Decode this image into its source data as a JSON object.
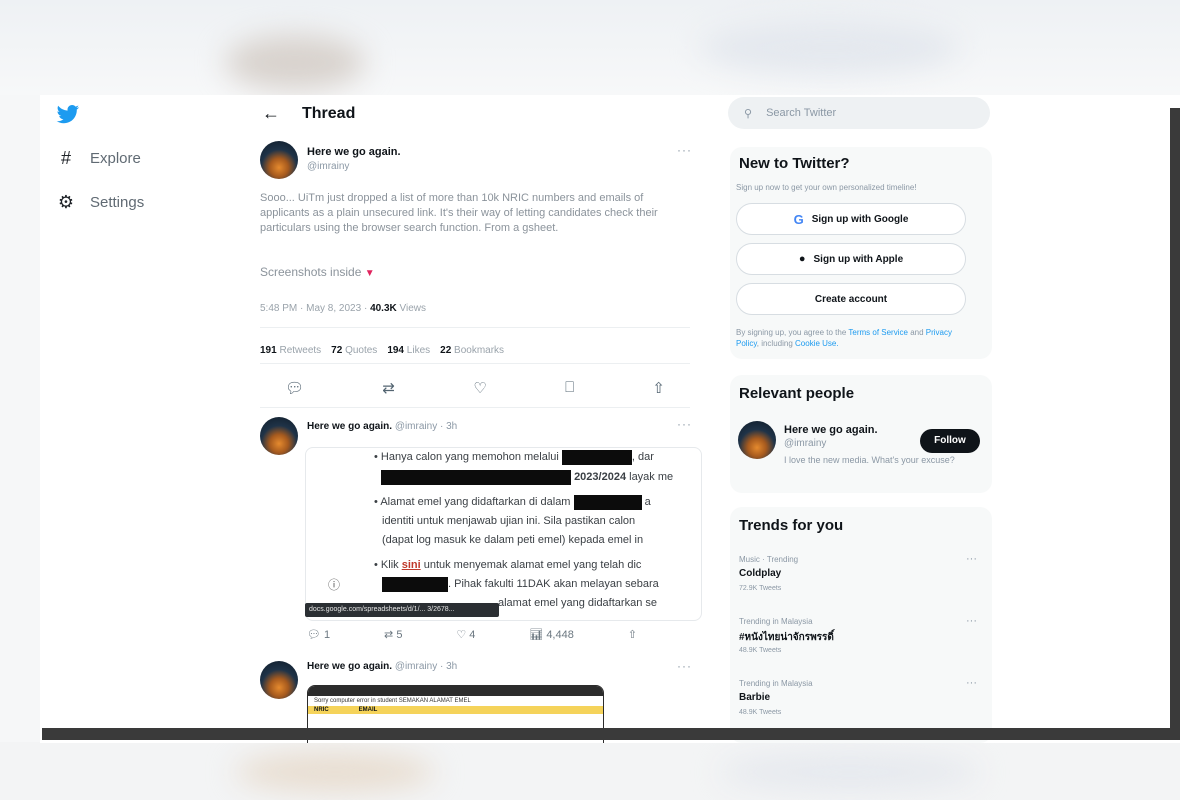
{
  "nav": {
    "explore_label": "Explore",
    "settings_label": "Settings"
  },
  "thread": {
    "title": "Thread",
    "main_tweet": {
      "name": "Here we go again.",
      "handle": "@imrainy",
      "text": "Sooo... UiTm just dropped a list of more than 10k NRIC numbers and emails of applicants as a plain unsecured link. It's their way of letting candidates check their particulars using the browser search function. From a gsheet.",
      "screenshots_line": "Screenshots inside",
      "time": "5:48 PM · May 8, 2023 ·",
      "views_count": "40.3K",
      "views_label": "Views",
      "stats": [
        {
          "count": "191",
          "label": "Retweets"
        },
        {
          "count": "72",
          "label": "Quotes"
        },
        {
          "count": "194",
          "label": "Likes"
        },
        {
          "count": "22",
          "label": "Bookmarks"
        }
      ]
    },
    "reply1": {
      "name": "Here we go again.",
      "handle": "@imrainy · 3h",
      "doc_line1": "Hanya calon yang memohon melalui",
      "doc_line1_end": ", dar",
      "doc_line2": "2023/2024",
      "doc_line2_end": " layak me",
      "doc_line3": "Alamat emel yang didaftarkan di dalam",
      "doc_line3_end": " a",
      "doc_line4": "identiti untuk menjawab ujian ini. Sila pastikan calon",
      "doc_line5": "(dapat log masuk ke dalam peti emel) kepada emel in",
      "doc_line6_a": "Klik ",
      "doc_line6_link": "sini",
      "doc_line6_b": " untuk menyemak alamat emel yang telah dic",
      "doc_line7": ". Pihak fakulti 11DAK akan melayan sebara",
      "doc_line8": "alamat emel yang didaftarkan se",
      "link_tip": "docs.google.com/spreadsheets/d/1/... 3/2678...",
      "actions": {
        "reply": "1",
        "retweet": "5",
        "like": "4",
        "views": "4,448"
      }
    },
    "reply2": {
      "name": "Here we go again.",
      "handle": "@imrainy · 3h",
      "img_header": "Sorry computer error in student   SEMAKAN ALAMAT EMEL",
      "col1": "NRIC",
      "col2": "EMAIL"
    }
  },
  "right": {
    "search_placeholder": "Search Twitter",
    "new_to_twitter": {
      "title": "New to Twitter?",
      "subtitle": "Sign up now to get your own personalized timeline!",
      "google_label": "Sign up with Google",
      "apple_label": "Sign up with Apple",
      "create_label": "Create account",
      "terms_prefix": "By signing up, you agree to the",
      "terms_link": "Terms of Service",
      "terms_and": "and",
      "privacy_link": "Privacy Policy",
      "terms_incl": ", including",
      "cookie_link": "Cookie Use."
    },
    "relevant_people": {
      "title": "Relevant people",
      "name": "Here we go again.",
      "handle": "@imrainy",
      "bio": "I love the new media. What's your excuse?",
      "follow_label": "Follow"
    },
    "trends": {
      "title": "Trends for you",
      "items": [
        {
          "category": "Music · Trending",
          "name": "Coldplay",
          "count": "72.9K Tweets"
        },
        {
          "category": "Trending in Malaysia",
          "name": "#หนังไทยน่าจักรพรรดิ์",
          "count": "48.9K Tweets"
        },
        {
          "category": "Trending in Malaysia",
          "name": "Barbie",
          "count": "48.9K Tweets"
        }
      ]
    }
  }
}
